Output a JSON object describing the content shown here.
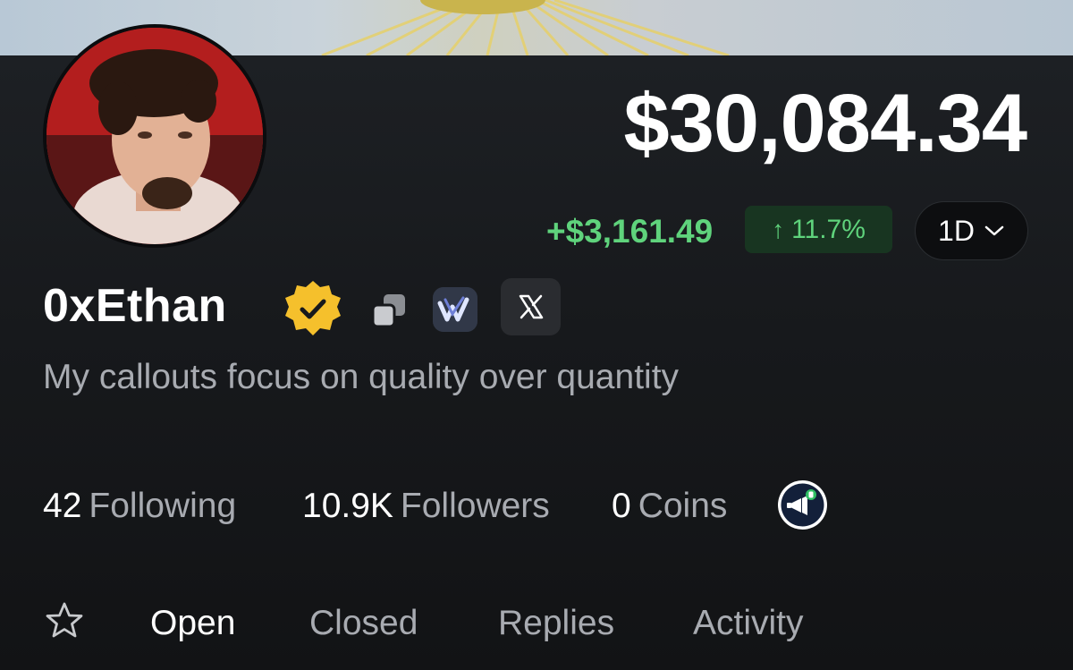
{
  "profile": {
    "name": "0xEthan",
    "bio": "My callouts focus on quality over quantity"
  },
  "portfolio": {
    "balance": "$30,084.34",
    "change": "+$3,161.49",
    "change_pct": "11.7%",
    "period": "1D"
  },
  "stats": [
    {
      "value": "42",
      "label": "Following"
    },
    {
      "value": "10.9K",
      "label": "Followers"
    },
    {
      "value": "0",
      "label": "Coins"
    }
  ],
  "tabs": [
    {
      "label": "Open",
      "active": true
    },
    {
      "label": "Closed",
      "active": false
    },
    {
      "label": "Replies",
      "active": false
    },
    {
      "label": "Activity",
      "active": false
    }
  ],
  "icons": {
    "verified": "verified-badge-icon",
    "copy": "copy-icon",
    "app": "app-logo-icon",
    "x": "x-logo-icon",
    "promo": "megaphone-icon",
    "favorite": "star-icon",
    "period_chevron": "chevron-down-icon"
  },
  "colors": {
    "positive": "#5fd37c",
    "positive_bg": "#183521",
    "verified_gold": "#f5c02c",
    "background": "#16181b"
  }
}
